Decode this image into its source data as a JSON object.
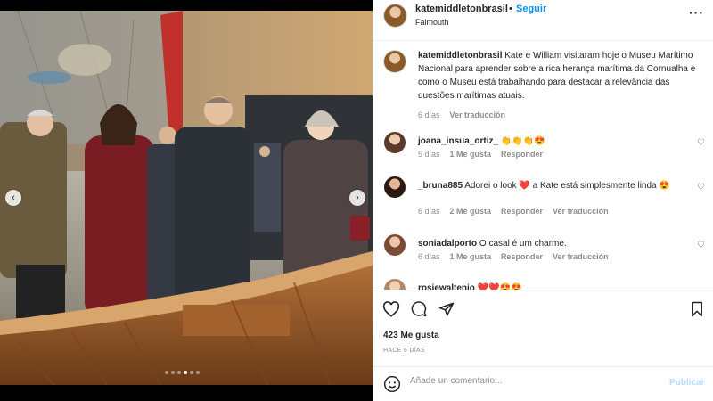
{
  "post": {
    "carousel": {
      "slide_count": 6,
      "active_index": 3
    }
  },
  "header": {
    "username": "katemiddletonbrasil",
    "separator": "•",
    "follow_label": "Seguir",
    "location": "Falmouth",
    "more_icon": "more-dots-icon"
  },
  "caption": {
    "username": "katemiddletonbrasil",
    "text": "Kate e William visitaram hoje o Museu Marítimo Nacional para aprender sobre a rica herança marítima da Cornualha e como o Museu está trabalhando para destacar a relevância das questões marítimas atuais.",
    "time": "6 días",
    "translate": "Ver traducción"
  },
  "comments": [
    {
      "username": "joana_insua_ortiz_",
      "text": "👏👏👏😍",
      "time": "5 días",
      "likes": "1 Me gusta",
      "reply": "Responder",
      "translate": ""
    },
    {
      "username": "_bruna885",
      "text": "Adorei o look ❤️ a Kate está simplesmente linda 😍",
      "time": "6 días",
      "likes": "2 Me gusta",
      "reply": "Responder",
      "translate": "Ver traducción"
    },
    {
      "username": "soniadalporto",
      "text": "O casal é um charme.",
      "time": "6 días",
      "likes": "1 Me gusta",
      "reply": "Responder",
      "translate": "Ver traducción"
    },
    {
      "username": "rosiewaltenio",
      "text": "❤️❤️😍😍",
      "time": "",
      "likes": "",
      "reply": "",
      "translate": ""
    }
  ],
  "actions": {
    "likes": "423 Me gusta",
    "ago": "HACE 6 DÍAS"
  },
  "add_comment": {
    "placeholder": "Añade un comentario...",
    "publish": "Publicar"
  },
  "colors": {
    "link": "#0095f6",
    "muted": "#8e8e8e",
    "publish_disabled": "#b2dffc"
  }
}
